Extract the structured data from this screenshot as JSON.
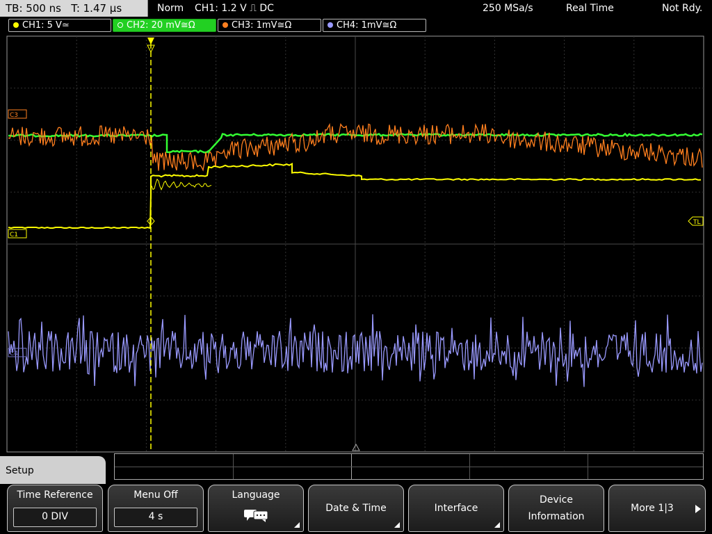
{
  "status": {
    "tb": "TB: 500 ns   T: 1.47 µs",
    "mode": "Norm",
    "trigger": "CH1: 1.2 V ⎍ DC",
    "rate": "250 MSa/s",
    "acq": "Real Time",
    "state": "Not Rdy."
  },
  "channels": [
    {
      "label": "CH1: 5 V≃",
      "color": "#ffff00"
    },
    {
      "label": "CH2: 20 mV≅Ω",
      "color": "#33ff33"
    },
    {
      "label": "CH3: 1mV≅Ω",
      "color": "#ff8020"
    },
    {
      "label": "CH4: 1mV≅Ω",
      "color": "#9a9aff"
    }
  ],
  "markers": {
    "c3": "C3",
    "c1": "C1",
    "c4": "C4",
    "tl": "TL"
  },
  "menu": {
    "title": "Setup",
    "buttons": [
      {
        "label": "Time Reference",
        "value": "0 DIV"
      },
      {
        "label": "Menu Off",
        "value": "4 s"
      },
      {
        "label": "Language",
        "icon": "speech-bubbles-icon"
      },
      {
        "label": "Date & Time"
      },
      {
        "label": "Interface"
      },
      {
        "label": "Device Information"
      },
      {
        "label": "More 1|3"
      }
    ]
  }
}
